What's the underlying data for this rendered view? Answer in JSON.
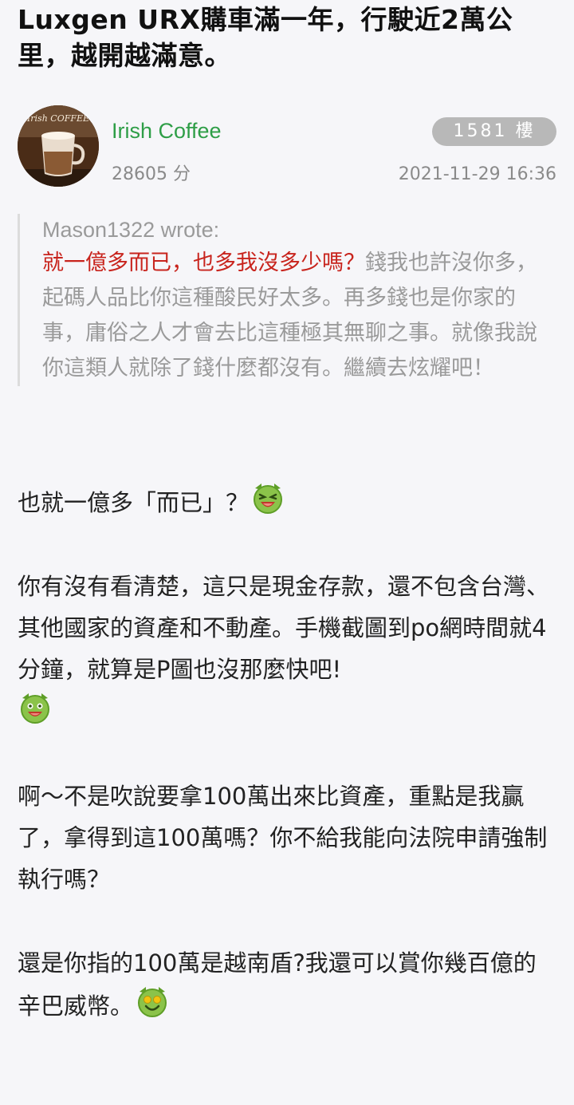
{
  "post": {
    "title": "Luxgen URX購車滿一年，行駛近2萬公里，越開越滿意。"
  },
  "author": {
    "name": "Irish Coffee",
    "points": "28605 分",
    "avatar_text": "Irish COFFEE",
    "floor": "1581 樓",
    "timestamp": "2021-11-29 16:36"
  },
  "quote": {
    "author": "Mason1322 wrote:",
    "highlight": "就一億多而已，也多我沒多少嗎？",
    "text": "錢我也許沒你多，起碼人品比你這種酸民好太多。再多錢也是你家的事，庸俗之人才會去比這種極其無聊之事。就像我說你這類人就除了錢什麼都沒有。繼續去炫耀吧！"
  },
  "body": {
    "p1": "也就一億多「而已」？",
    "p2": "你有沒有看清楚，這只是現金存款，還不包含台灣、其他國家的資產和不動產。手機截圖到po網時間就4分鐘，就算是P圖也沒那麼快吧!",
    "p3": "啊～不是吹說要拿100萬出來比資產，重點是我贏了，拿得到這100萬嗎？你不給我能向法院申請強制執行嗎？",
    "p4": "還是你指的100萬是越南盾?我還可以賞你幾百億的辛巴威幣。"
  },
  "icons": {
    "emoji_1": "laughing-green-emoji-icon",
    "emoji_2": "happy-green-emoji-icon",
    "emoji_3": "money-eyes-green-emoji-icon"
  },
  "colors": {
    "author_name": "#2e9e47",
    "quote_highlight": "#c8241d",
    "floor_badge": "#b8b8b8"
  }
}
